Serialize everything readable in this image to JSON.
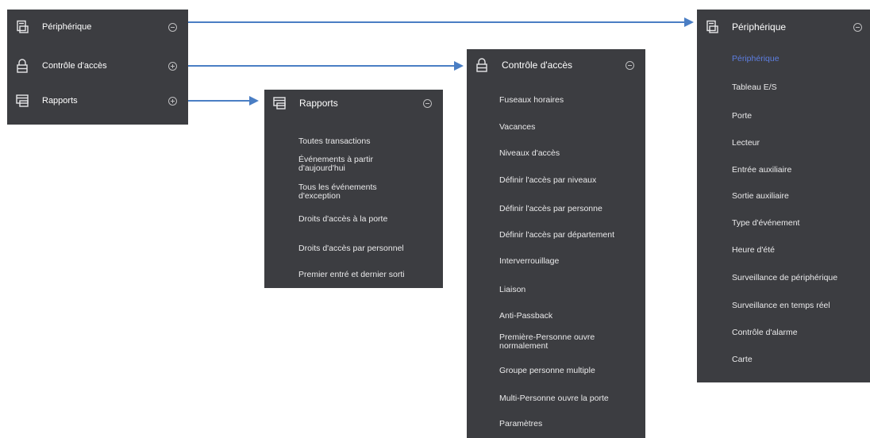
{
  "colors": {
    "panel_bg": "#3c3d41",
    "text": "#eaeaeb",
    "active": "#5d7ee0",
    "arrow": "#4a7ec4"
  },
  "main_menu": {
    "items": [
      {
        "label": "Périphérique",
        "icon": "device-icon",
        "toggle": "collapse"
      },
      {
        "label": "Contrôle d'accès",
        "icon": "lock-icon",
        "toggle": "expand"
      },
      {
        "label": "Rapports",
        "icon": "report-icon",
        "toggle": "expand"
      }
    ]
  },
  "reports_menu": {
    "title": "Rapports",
    "items": [
      "Toutes transactions",
      "Événements à partir d'aujourd'hui",
      "Tous les événements d'exception",
      "Droits d'accès à la porte",
      "Droits d'accès par personnel",
      "Premier entré et dernier sorti"
    ]
  },
  "access_menu": {
    "title": "Contrôle d'accès",
    "items": [
      "Fuseaux horaires",
      "Vacances",
      "Niveaux d'accès",
      "Définir l'accès par niveaux",
      "Définir l'accès par personne",
      "Définir l'accès par département",
      "Interverrouillage",
      "Liaison",
      "Anti-Passback",
      "Première-Personne ouvre normalement",
      "Groupe personne multiple",
      "Multi-Personne ouvre la porte",
      "Paramètres"
    ]
  },
  "device_menu": {
    "title": "Périphérique",
    "items": [
      "Périphérique",
      "Tableau E/S",
      "Porte",
      "Lecteur",
      "Entrée auxiliaire",
      "Sortie auxiliaire",
      "Type d'événement",
      "Heure d'été",
      "Surveillance de périphérique",
      "Surveillance en temps réel",
      "Contrôle d'alarme",
      "Carte"
    ],
    "active_index": 0
  }
}
